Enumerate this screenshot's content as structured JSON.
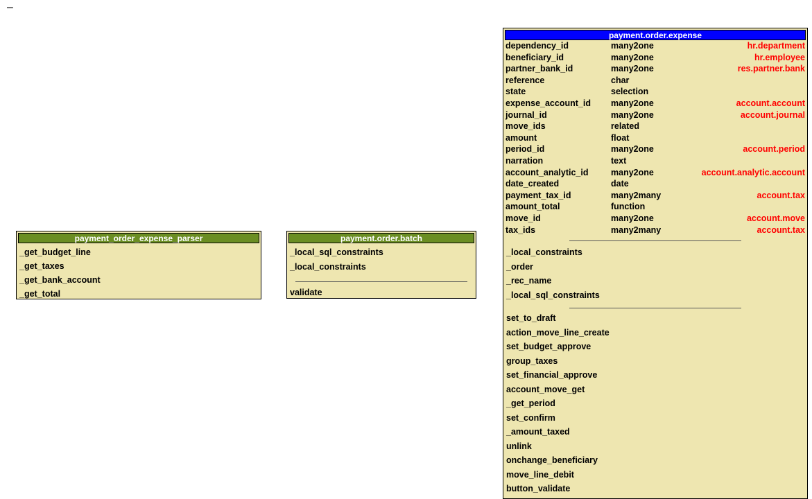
{
  "corner_mark": "–",
  "parser_box": {
    "title": "payment_order_expense_parser",
    "header_color": "#6b8e23",
    "methods": [
      "_get_budget_line",
      "_get_taxes",
      "_get_bank_account",
      "_get_total"
    ]
  },
  "batch_box": {
    "title": "payment.order.batch",
    "header_color": "#6b8e23",
    "constraints": [
      "_local_sql_constraints",
      "_local_constraints"
    ],
    "methods": [
      "validate"
    ]
  },
  "expense_box": {
    "title": "payment.order.expense",
    "header_color": "#0000ff",
    "relation_color": "#ff0000",
    "fields": [
      {
        "name": "dependency_id",
        "type": "many2one",
        "relation": "hr.department"
      },
      {
        "name": "beneficiary_id",
        "type": "many2one",
        "relation": "hr.employee"
      },
      {
        "name": "partner_bank_id",
        "type": "many2one",
        "relation": "res.partner.bank"
      },
      {
        "name": "reference",
        "type": "char",
        "relation": ""
      },
      {
        "name": "state",
        "type": "selection",
        "relation": ""
      },
      {
        "name": "expense_account_id",
        "type": "many2one",
        "relation": "account.account"
      },
      {
        "name": "journal_id",
        "type": "many2one",
        "relation": "account.journal"
      },
      {
        "name": "move_ids",
        "type": "related",
        "relation": ""
      },
      {
        "name": "amount",
        "type": "float",
        "relation": ""
      },
      {
        "name": "period_id",
        "type": "many2one",
        "relation": "account.period"
      },
      {
        "name": "narration",
        "type": "text",
        "relation": ""
      },
      {
        "name": "account_analytic_id",
        "type": "many2one",
        "relation": "account.analytic.account"
      },
      {
        "name": "date_created",
        "type": "date",
        "relation": ""
      },
      {
        "name": "payment_tax_id",
        "type": "many2many",
        "relation": "account.tax"
      },
      {
        "name": "amount_total",
        "type": "function",
        "relation": ""
      },
      {
        "name": "move_id",
        "type": "many2one",
        "relation": "account.move"
      },
      {
        "name": "tax_ids",
        "type": "many2many",
        "relation": "account.tax"
      }
    ],
    "attributes": [
      "_local_constraints",
      "_order",
      "_rec_name",
      "_local_sql_constraints"
    ],
    "methods": [
      "set_to_draft",
      "action_move_line_create",
      "set_budget_approve",
      "group_taxes",
      "set_financial_approve",
      "account_move_get",
      "_get_period",
      "set_confirm",
      "_amount_taxed",
      "unlink",
      "onchange_beneficiary",
      "move_line_debit",
      "button_validate"
    ]
  }
}
